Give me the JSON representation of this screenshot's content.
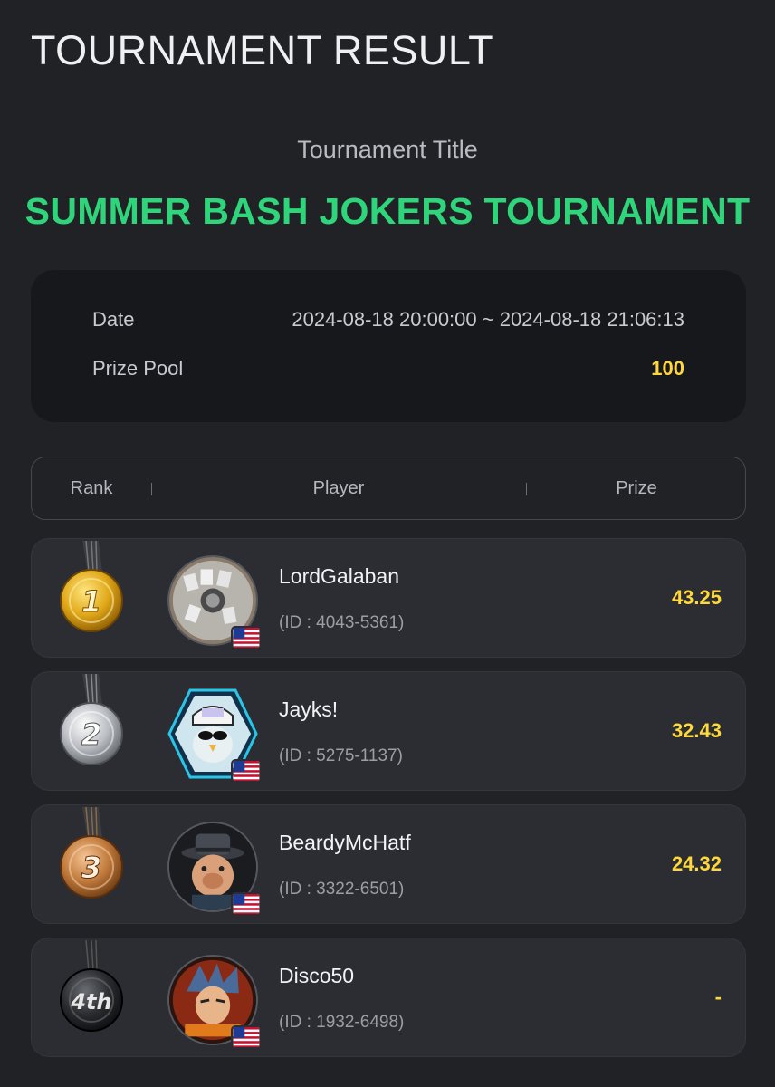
{
  "header": {
    "title": "TOURNAMENT RESULT"
  },
  "tournament": {
    "title_label": "Tournament Title",
    "name": "SUMMER BASH JOKERS TOURNAMENT"
  },
  "info": {
    "date_label": "Date",
    "date_value": "2024-08-18 20:00:00 ~ 2024-08-18 21:06:13",
    "prize_pool_label": "Prize Pool",
    "prize_pool_value": "100"
  },
  "table": {
    "columns": [
      "Rank",
      "Player",
      "Prize"
    ],
    "rows": [
      {
        "rank": "1",
        "medal": "gold-medal-icon",
        "name": "LordGalaban",
        "id": "(ID : 4043-5361)",
        "prize": "43.25",
        "flag": "us-flag-icon"
      },
      {
        "rank": "2",
        "medal": "silver-medal-icon",
        "name": "Jayks!",
        "id": "(ID : 5275-1137)",
        "prize": "32.43",
        "flag": "us-flag-icon"
      },
      {
        "rank": "3",
        "medal": "bronze-medal-icon",
        "name": "BeardyMcHatf",
        "id": "(ID : 3322-6501)",
        "prize": "24.32",
        "flag": "us-flag-icon"
      },
      {
        "rank": "4th",
        "medal": "black-medal-icon",
        "name": "Disco50",
        "id": "(ID : 1932-6498)",
        "prize": "-",
        "flag": "us-flag-icon"
      }
    ]
  },
  "colors": {
    "background": "#202226",
    "accent_green": "#2fd57a",
    "prize_yellow": "#ffd93a",
    "card": "#2b2d33"
  }
}
